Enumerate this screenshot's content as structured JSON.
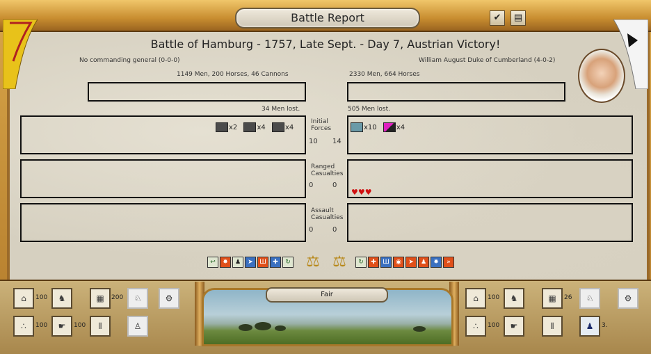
{
  "window": {
    "title": "Battle Report",
    "confirm_icon": "checkmark-icon",
    "log_icon": "document-icon"
  },
  "battle": {
    "title": "Battle of Hamburg - 1757, Late Sept. - Day 7, Austrian Victory!"
  },
  "left": {
    "general": "No commanding general (0-0-0)",
    "strength": "1149 Men, 200 Horses, 46 Cannons",
    "lost": "34 Men lost.",
    "initial_units": [
      {
        "icon": "infantry-icon",
        "count": "x2",
        "color": "#4b4b4b"
      },
      {
        "icon": "cavalry-icon",
        "count": "x4",
        "color": "#4b4b4b"
      },
      {
        "icon": "artillery-icon",
        "count": "x4",
        "color": "#4b4b4b"
      }
    ],
    "initial_forces": "10",
    "ranged_casualties": "0",
    "assault_casualties": "0"
  },
  "right": {
    "general": "William August Duke of Cumberland (4-0-2)",
    "strength": "2330 Men, 664 Horses",
    "lost": "505 Men lost.",
    "initial_units": [
      {
        "icon": "infantry-icon",
        "count": "x10",
        "color": "#6a9aa8"
      },
      {
        "icon": "cavalry-icon",
        "count": "x4",
        "color": "#e020c0"
      }
    ],
    "initial_forces": "14",
    "ranged_casualties": "0",
    "assault_casualties": "0",
    "hearts": "♥♥♥"
  },
  "center_labels": {
    "initial": "Initial Forces",
    "ranged": "Ranged Casualties",
    "assault": "Assault Casualties"
  },
  "bottom": {
    "weather": "Fair",
    "left_slots": [
      {
        "icon": "fortification-icon",
        "value": "100"
      },
      {
        "icon": "officer-icon",
        "value": ""
      },
      {
        "icon": "supply-wagon-icon",
        "value": "200"
      },
      {
        "icon": "scout-icon",
        "value": ""
      },
      {
        "icon": "cannon-icon",
        "value": ""
      },
      {
        "icon": "ammunition-icon",
        "value": "100"
      },
      {
        "icon": "pointing-hand-icon",
        "value": "100"
      },
      {
        "icon": "soldiers-column-icon",
        "value": ""
      },
      {
        "icon": "runner-icon",
        "value": ""
      }
    ],
    "right_slots": [
      {
        "icon": "fortification-icon",
        "value": "100"
      },
      {
        "icon": "officer-icon",
        "value": ""
      },
      {
        "icon": "supply-wagon-icon",
        "value": "26"
      },
      {
        "icon": "scout-icon",
        "value": ""
      },
      {
        "icon": "cannon-icon",
        "value": ""
      },
      {
        "icon": "ammunition-icon",
        "value": "100"
      },
      {
        "icon": "pointing-hand-icon",
        "value": ""
      },
      {
        "icon": "soldiers-column-icon",
        "value": ""
      },
      {
        "icon": "grenadier-icon",
        "value": "3."
      }
    ]
  }
}
